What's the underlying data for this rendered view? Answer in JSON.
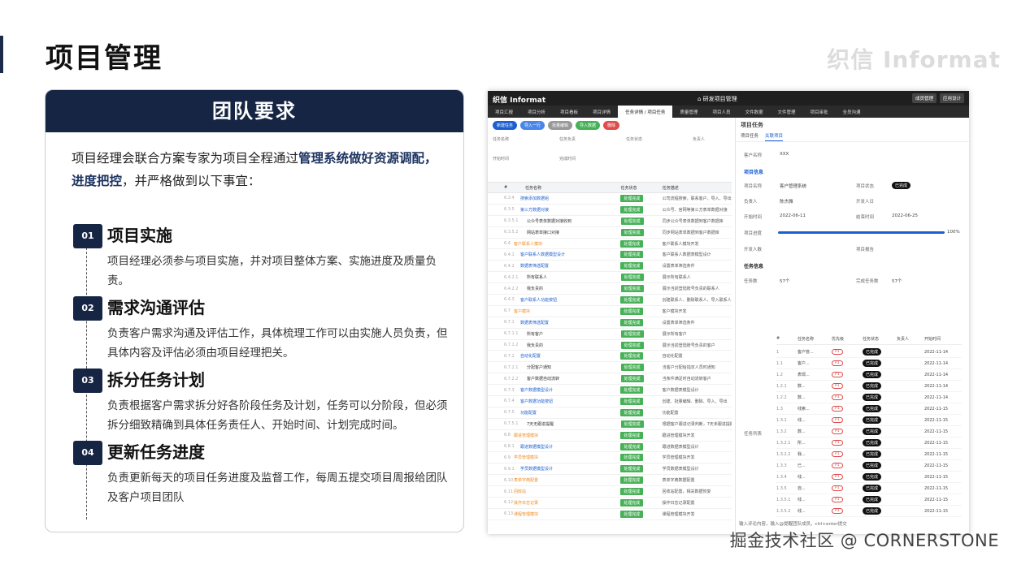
{
  "page": {
    "title": "项目管理",
    "brand": "织信 Informat"
  },
  "card": {
    "header": "团队要求",
    "intro_pre": "项目经理会联合方案专家为项目全程通过",
    "intro_bold": "管理系统做好资源调配，进度把控",
    "intro_post": "，并严格做到以下事宜：",
    "steps": [
      {
        "num": "01",
        "title": "项目实施",
        "desc": "项目经理必须参与项目实施，并对项目整体方案、实施进度及质量负责。"
      },
      {
        "num": "02",
        "title": "需求沟通评估",
        "desc": "负责客户需求沟通及评估工作，具体梳理工作可以由实施人员负责，但具体内容及评估必须由项目经理把关。"
      },
      {
        "num": "03",
        "title": "拆分任务计划",
        "desc": "负责根据客户需求拆分好各阶段任务及计划，任务可以分阶段，但必须拆分细致精确到具体任务责任人、开始时间、计划完成时间。"
      },
      {
        "num": "04",
        "title": "更新任务进度",
        "desc": "负责更新每天的项目任务进度及监督工作，每周五提交项目周报给团队及客户项目团队"
      }
    ]
  },
  "screenshot": {
    "logo": "织信 Informat",
    "center_title": "研发项目管理",
    "top_buttons": [
      "成员管理",
      "应用设计"
    ],
    "tabs": [
      "项目汇报",
      "项目分析",
      "项目看板",
      "项目详情",
      "任务详情 / 项目任务",
      "质量管理",
      "项目人员",
      "文件数据",
      "文件管理",
      "项目审批",
      "全员沟通"
    ],
    "active_tab": 4,
    "toolbar": [
      "新建任务",
      "导入一行",
      "批量编辑",
      "导入数据",
      "删除"
    ],
    "filters": [
      "任务名称",
      "任务负责",
      "任务状态",
      "负责人",
      "开始时间",
      "完成时间"
    ],
    "grid_header": [
      "#",
      "任务名称",
      "任务状态",
      "任务描述"
    ],
    "rows": [
      {
        "n": "6.3.4",
        "name": "搜索添加数据组",
        "status": "处理完成",
        "desc": "公司流程搜索，联系客户、导入、导出、批量"
      },
      {
        "n": "6.3.5",
        "name": "第三方数据对接",
        "status": "处理完成",
        "desc": "公众号、官网等第三方表单数据对接"
      },
      {
        "n": "6.3.5.1",
        "name": "公众号表单数据对接收到",
        "status": "处理完成",
        "desc": "同步公众号表单数据到客户数据库"
      },
      {
        "n": "6.3.5.2",
        "name": "网站表单接口对接",
        "status": "处理完成",
        "desc": "同步网站表单数据到客户数据库"
      },
      {
        "n": "6.4",
        "name": "客户联系人模块",
        "status": "处理完成",
        "desc": "客户联系人模块开发"
      },
      {
        "n": "6.4.1",
        "name": "客户联系人数据模型设计",
        "status": "处理完成",
        "desc": "客户联系人数据表模型设计"
      },
      {
        "n": "6.4.2",
        "name": "数据表筛选配置",
        "status": "处理完成",
        "desc": "设置表单筛选条件"
      },
      {
        "n": "6.4.2.1",
        "name": "所有联系人",
        "status": "处理完成",
        "desc": "展示所有联系人"
      },
      {
        "n": "6.4.2.2",
        "name": "我负责的",
        "status": "处理完成",
        "desc": "展示当前登陆账号负责的联系人"
      },
      {
        "n": "6.4.3",
        "name": "客户联系人功能按钮",
        "status": "处理完成",
        "desc": "创建联系人、删除联系人、导入联系人"
      },
      {
        "n": "6.7",
        "name": "客户模块",
        "status": "处理完成",
        "desc": "客户模块开发"
      },
      {
        "n": "6.7.1",
        "name": "数据表筛选配置",
        "status": "处理完成",
        "desc": "设置表单筛选条件"
      },
      {
        "n": "6.7.1.1",
        "name": "所有客户",
        "status": "处理完成",
        "desc": "展示所有客户"
      },
      {
        "n": "6.7.1.2",
        "name": "我负责的",
        "status": "处理完成",
        "desc": "展示当前登陆账号负责的客户"
      },
      {
        "n": "6.7.2",
        "name": "自动化配置",
        "status": "处理完成",
        "desc": "自动化配置"
      },
      {
        "n": "6.7.2.1",
        "name": "分配客户通知",
        "status": "处理完成",
        "desc": "当客户分配给指定人员时通知"
      },
      {
        "n": "6.7.2.2",
        "name": "客户数据自动流转",
        "status": "处理完成",
        "desc": "当条件满足时自动流转客户"
      },
      {
        "n": "6.7.3",
        "name": "客户数据模型设计",
        "status": "处理完成",
        "desc": "客户数据表模型设计"
      },
      {
        "n": "6.7.4",
        "name": "客户数据功能按钮",
        "status": "处理完成",
        "desc": "创建、批量编辑、删除、导入、导出"
      },
      {
        "n": "6.7.5",
        "name": "功能配置",
        "status": "处理完成",
        "desc": "功能配置"
      },
      {
        "n": "6.7.5.1",
        "name": "7天无跟进提醒",
        "status": "处理完成",
        "desc": "根据客户跟进记录判断，7天未跟进提醒"
      },
      {
        "n": "6.8",
        "name": "跟进管理模块",
        "status": "处理完成",
        "desc": "跟进管理模块开发"
      },
      {
        "n": "6.8.1",
        "name": "跟进数据模型设计",
        "status": "处理完成",
        "desc": "跟进数据表模型设计"
      },
      {
        "n": "6.9",
        "name": "学员管理模块",
        "status": "处理完成",
        "desc": "学员管理模块开发"
      },
      {
        "n": "6.9.1",
        "name": "学员数据模型设计",
        "status": "处理完成",
        "desc": "学员数据表模型设计"
      },
      {
        "n": "6.10",
        "name": "表单字典配置",
        "status": "处理完成",
        "desc": "表单字典数据配置"
      },
      {
        "n": "6.11",
        "name": "回收站",
        "status": "处理完成",
        "desc": "回收站配置，相关数据恢复"
      },
      {
        "n": "6.12",
        "name": "操作日志记录",
        "status": "处理完成",
        "desc": "操作日志记录配置"
      },
      {
        "n": "6.13",
        "name": "课程管理模块",
        "status": "处理完成",
        "desc": "课程管理模块开发"
      }
    ],
    "detail": {
      "title": "项目任务",
      "tabs": [
        "项目任务",
        "关联项目"
      ],
      "customer_label": "客户名称",
      "customer_value": "XXX",
      "section1": "项目信息",
      "project_name_label": "项目名称",
      "project_name_value": "客户管理系统",
      "project_status_label": "项目状态",
      "project_status_value": "已完成",
      "owner_label": "负责人",
      "owner_value": "陈杰雅",
      "dev_date_label": "开发人日",
      "start_label": "开始时间",
      "start_value": "2022-06-11",
      "end_label": "结束时间",
      "end_value": "2022-06-25",
      "progress_label": "项目进度",
      "progress_value": "100%",
      "progress_fraction": 1.0,
      "dev_people_label": "开发人数",
      "report_label": "项目报告",
      "section2": "任务信息",
      "task_count_label": "任务数",
      "task_count_value": "57个",
      "done_count_label": "完成任务数",
      "done_count_value": "57个",
      "task_list_label": "任务列表",
      "sub_header": [
        "#",
        "任务名称",
        "优先级",
        "任务状态",
        "负责人",
        "开始时间"
      ],
      "sub_rows": [
        {
          "n": "1",
          "name": "客户管...",
          "pri": "P1",
          "st": "已完成",
          "date": "2022-11-14"
        },
        {
          "n": "1.1",
          "name": "客户...",
          "pri": "P1",
          "st": "已完成",
          "date": "2022-11-14"
        },
        {
          "n": "1.2",
          "name": "表现...",
          "pri": "P1",
          "st": "已完成",
          "date": "2022-11-14"
        },
        {
          "n": "1.2.1",
          "name": "数...",
          "pri": "P1",
          "st": "已完成",
          "date": "2022-11-14"
        },
        {
          "n": "1.2.2",
          "name": "数...",
          "pri": "P1",
          "st": "已完成",
          "date": "2022-11-14"
        },
        {
          "n": "1.3",
          "name": "线索...",
          "pri": "P1",
          "st": "已完成",
          "date": "2022-11-15"
        },
        {
          "n": "1.3.1",
          "name": "线...",
          "pri": "P1",
          "st": "已完成",
          "date": "2022-11-15"
        },
        {
          "n": "1.3.2",
          "name": "数...",
          "pri": "P1",
          "st": "已完成",
          "date": "2022-11-15"
        },
        {
          "n": "1.3.2.1",
          "name": "所...",
          "pri": "P1",
          "st": "已完成",
          "date": "2022-11-15"
        },
        {
          "n": "1.3.2.2",
          "name": "我...",
          "pri": "P1",
          "st": "已完成",
          "date": "2022-11-15"
        },
        {
          "n": "1.3.3",
          "name": "已...",
          "pri": "P1",
          "st": "已完成",
          "date": "2022-11-15"
        },
        {
          "n": "1.3.4",
          "name": "线...",
          "pri": "P1",
          "st": "已完成",
          "date": "2022-11-15"
        },
        {
          "n": "1.3.5",
          "name": "自...",
          "pri": "P1",
          "st": "已完成",
          "date": "2022-11-15"
        },
        {
          "n": "1.3.5.1",
          "name": "线...",
          "pri": "P1",
          "st": "已完成",
          "date": "2022-11-15"
        },
        {
          "n": "1.3.5.2",
          "name": "线...",
          "pri": "P1",
          "st": "已完成",
          "date": "2022-11-15"
        }
      ],
      "input_placeholder": "输入评论内容，输入@提醒团队成员，ctrl+enter提交"
    }
  },
  "watermark": "掘金技术社区 @ CORNERSTONE",
  "colors": {
    "navy": "#162544",
    "blue": "#1d5fd1",
    "green": "#47b157",
    "orange": "#f08a1c"
  }
}
